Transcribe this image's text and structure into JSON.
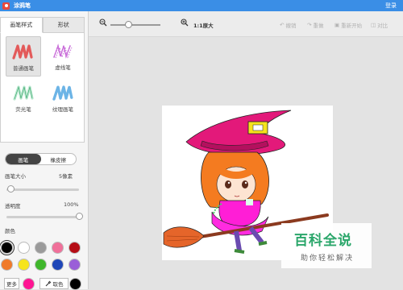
{
  "app": {
    "title": "涂鸦笔",
    "login": "登录"
  },
  "sidebar": {
    "tabs": [
      {
        "label": "画笔样式"
      },
      {
        "label": "形状"
      }
    ],
    "brushes": [
      {
        "label": "普通画笔",
        "color": "#e35a5a"
      },
      {
        "label": "虚线笔",
        "color": "#c86ad8"
      },
      {
        "label": "荧光笔",
        "color": "#7fd7a8"
      },
      {
        "label": "纹理画笔",
        "color": "#6cb4e6"
      }
    ],
    "mode": {
      "brush": "画笔",
      "eraser": "橡皮擦"
    },
    "size": {
      "label": "画笔大小",
      "value": "5像素",
      "level": 0.05
    },
    "opacity": {
      "label": "透明度",
      "value": "100%",
      "level": 1.0
    },
    "colors_label": "颜色",
    "palette": [
      "#000000",
      "#ffffff",
      "#9a9a9a",
      "#f0709a",
      "#b50d15",
      "#f07a2a",
      "#f6e41b",
      "#3fb62b",
      "#1e46b8",
      "#9a5fd8"
    ],
    "more_label": "更多",
    "more_color": "#ff1493",
    "picker_label": "取色",
    "current_color": "#000000"
  },
  "toolbar": {
    "zoom_level": 0.35,
    "actual_size": "1:1原大",
    "undo": "撤销",
    "redo": "重做",
    "restart": "重新开始",
    "compare": "对比"
  },
  "watermark": {
    "main": "百科全说",
    "sub": "助你轻松解决"
  }
}
